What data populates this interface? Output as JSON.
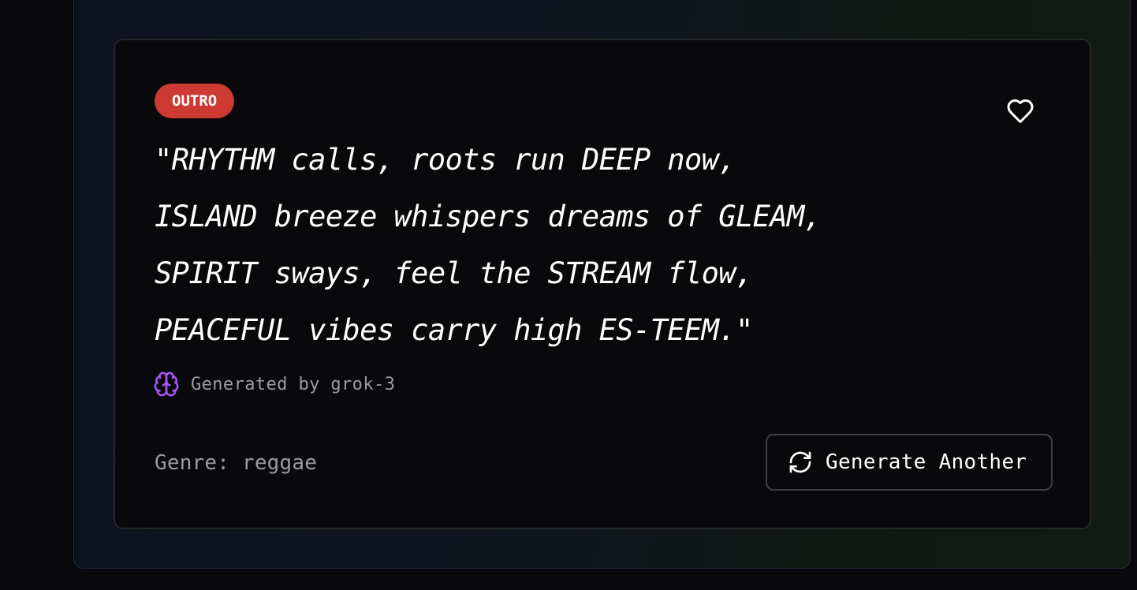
{
  "card": {
    "section_badge": "OUTRO",
    "badge_color": "#cc3a32",
    "favorite_icon": "heart-icon",
    "lyrics": [
      "\"RHYTHM calls, roots run DEEP now,",
      "ISLAND breeze whispers dreams of GLEAM,",
      "SPIRIT sways, feel the STREAM flow,",
      "PEACEFUL vibes carry high ES-TEEM.\""
    ],
    "attribution": {
      "icon": "brain-icon",
      "icon_color": "#a855f7",
      "text": "Generated by grok-3"
    },
    "genre_text": "Genre: reggae",
    "generate_button": {
      "icon": "refresh-icon",
      "label": "Generate Another"
    }
  }
}
